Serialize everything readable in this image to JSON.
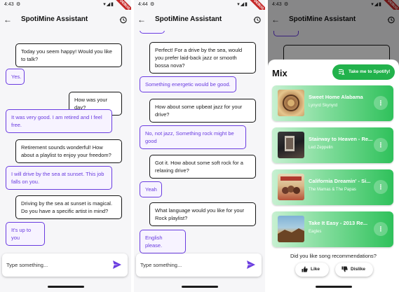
{
  "status": {
    "time_1": "4:43",
    "time_2": "4:44",
    "time_3": "4:43",
    "debug": "DEBUG"
  },
  "appbar": {
    "title": "SpotiMine Assistant"
  },
  "composer": {
    "placeholder": "Type something..."
  },
  "screen1": {
    "messages": [
      {
        "role": "bot",
        "text": "Today you seem happy! Would you like to talk?"
      },
      {
        "role": "user",
        "text": "Yes."
      },
      {
        "role": "bot",
        "text": "How was your day?"
      },
      {
        "role": "user",
        "text": "It was very good. I am retired and I feel free."
      },
      {
        "role": "bot",
        "text": "Retirement sounds wonderful! How about a playlist to enjoy your freedom?"
      },
      {
        "role": "user",
        "text": "I will drive by the sea at sunset. This job falls on you."
      },
      {
        "role": "bot",
        "text": "Driving by the sea at sunset is magical. Do you have a specific artist in mind?"
      },
      {
        "role": "user",
        "text": "It's up to you"
      }
    ]
  },
  "screen2": {
    "messages": [
      {
        "role": "bot",
        "text": "Perfect! For a drive by the sea, would you prefer laid-back jazz or smooth bossa nova?"
      },
      {
        "role": "user",
        "text": "Something energetic would be good."
      },
      {
        "role": "bot",
        "text": "How about some upbeat jazz for your drive?"
      },
      {
        "role": "user",
        "text": "No, not jazz, Something rock might be good"
      },
      {
        "role": "bot",
        "text": "Got it. How about some soft rock for a relaxing drive?"
      },
      {
        "role": "user",
        "text": "Yeah"
      },
      {
        "role": "bot",
        "text": "What language would you like for your Rock playlist?"
      },
      {
        "role": "user",
        "text": "English please."
      }
    ]
  },
  "mix": {
    "title": "Mix",
    "spotify_button": "Take me to Spotify!",
    "songs": [
      {
        "title": "Sweet Home Alabama",
        "artist": "Lynyrd Skynyrd",
        "more": "⋮"
      },
      {
        "title": "Stairway to Heaven - Re...",
        "artist": "Led Zeppelin",
        "more": "⋮"
      },
      {
        "title": "California Dreamin' - Si...",
        "artist": "The Mamas & The Papas",
        "more": "⋮"
      },
      {
        "title": "Take It Easy - 2013 Re...",
        "artist": "Eagles",
        "more": "⋮"
      }
    ],
    "question": "Did you like song recommendations?",
    "like": "Like",
    "dislike": "Dislike"
  },
  "colors": {
    "user_bubble": "#6a3ce0",
    "bot_bubble": "#141414",
    "spotify_green": "#22b24c"
  }
}
